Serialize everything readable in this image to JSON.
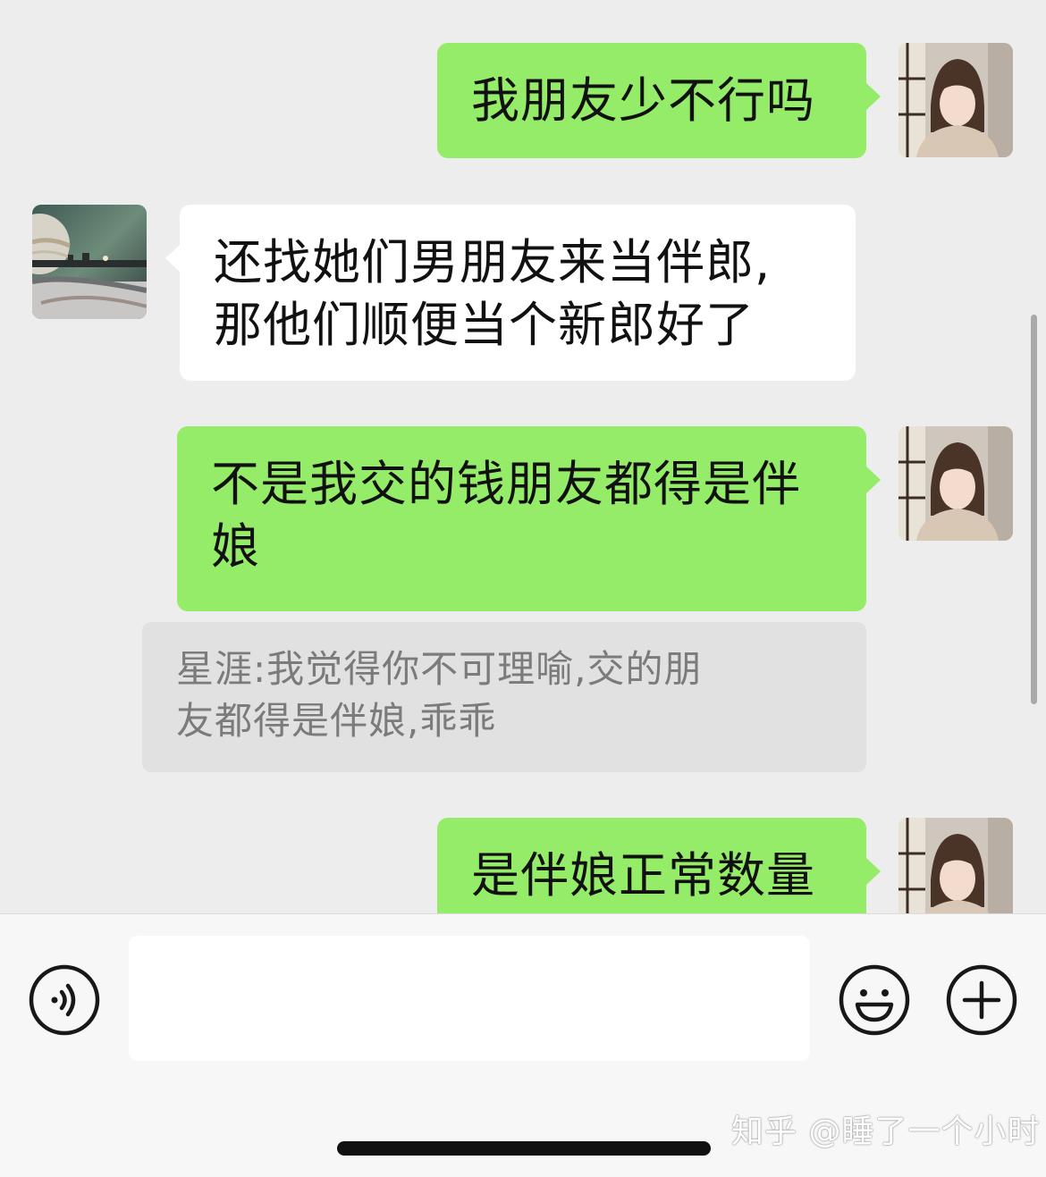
{
  "messages": [
    {
      "side": "out",
      "text": "我朋友少不行吗"
    },
    {
      "side": "in",
      "lines": [
        "还找她们男朋友来当伴郎,",
        "那他们顺便当个新郎好了"
      ]
    },
    {
      "side": "out",
      "lines": [
        "不是我交的钱朋友都得是伴",
        "娘"
      ]
    },
    {
      "side": "quote",
      "lines": [
        "星涯:我觉得你不可理喻,交的朋",
        "友都得是伴娘,乖乖"
      ]
    },
    {
      "side": "out",
      "text": "是伴娘正常数量"
    }
  ],
  "input": {
    "value": "",
    "placeholder": ""
  },
  "icons": {
    "voice": "voice-icon",
    "emoji": "emoji-icon",
    "plus": "plus-icon"
  },
  "watermark": "知乎 @睡了一个小时",
  "colors": {
    "outgoing_bubble": "#95ec69",
    "incoming_bubble": "#ffffff",
    "quote_bubble": "#e1e1e1",
    "background": "#ededed"
  }
}
